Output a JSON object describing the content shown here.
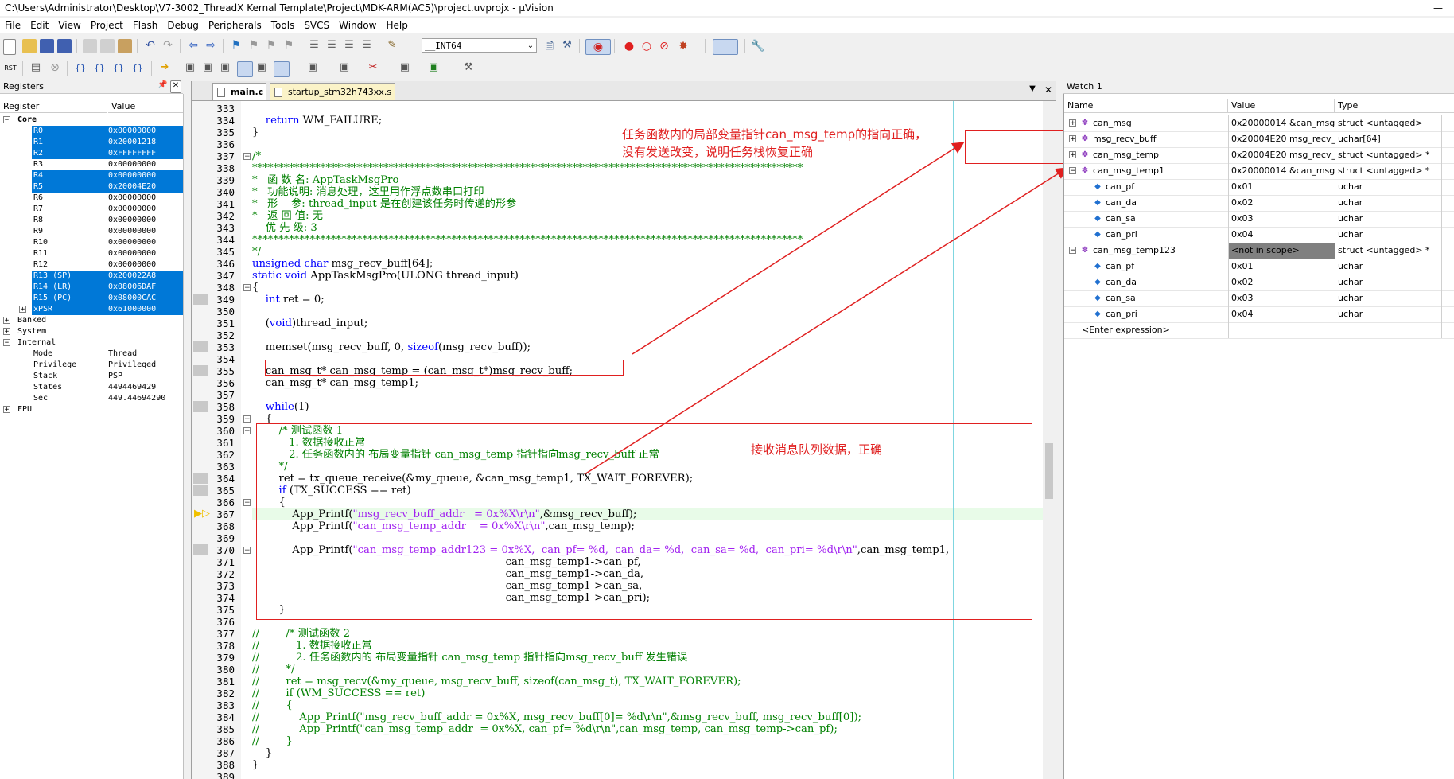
{
  "window": {
    "title": "C:\\Users\\Administrator\\Desktop\\V7-3002_ThreadX Kernal Template\\Project\\MDK-ARM(AC5)\\project.uvprojx - µVision"
  },
  "menu": [
    "File",
    "Edit",
    "View",
    "Project",
    "Flash",
    "Debug",
    "Peripherals",
    "Tools",
    "SVCS",
    "Window",
    "Help"
  ],
  "toolbar": {
    "combo_value": "__INT64"
  },
  "registers": {
    "title": "Registers",
    "col_register": "Register",
    "col_value": "Value",
    "rows": [
      {
        "name": "Core",
        "value": "",
        "level": 0,
        "exp": "−",
        "bold": true,
        "sel": false
      },
      {
        "name": "R0",
        "value": "0x00000000",
        "level": 2,
        "sel": true
      },
      {
        "name": "R1",
        "value": "0x20001218",
        "level": 2,
        "sel": true
      },
      {
        "name": "R2",
        "value": "0xFFFFFFFF",
        "level": 2,
        "sel": true
      },
      {
        "name": "R3",
        "value": "0x00000000",
        "level": 2,
        "sel": false
      },
      {
        "name": "R4",
        "value": "0x00000000",
        "level": 2,
        "sel": true
      },
      {
        "name": "R5",
        "value": "0x20004E20",
        "level": 2,
        "sel": true
      },
      {
        "name": "R6",
        "value": "0x00000000",
        "level": 2,
        "sel": false
      },
      {
        "name": "R7",
        "value": "0x00000000",
        "level": 2,
        "sel": false
      },
      {
        "name": "R8",
        "value": "0x00000000",
        "level": 2,
        "sel": false
      },
      {
        "name": "R9",
        "value": "0x00000000",
        "level": 2,
        "sel": false
      },
      {
        "name": "R10",
        "value": "0x00000000",
        "level": 2,
        "sel": false
      },
      {
        "name": "R11",
        "value": "0x00000000",
        "level": 2,
        "sel": false
      },
      {
        "name": "R12",
        "value": "0x00000000",
        "level": 2,
        "sel": false
      },
      {
        "name": "R13 (SP)",
        "value": "0x200022A8",
        "level": 2,
        "sel": true
      },
      {
        "name": "R14 (LR)",
        "value": "0x08006DAF",
        "level": 2,
        "sel": true
      },
      {
        "name": "R15 (PC)",
        "value": "0x08000CAC",
        "level": 2,
        "sel": true
      },
      {
        "name": "xPSR",
        "value": "0x61000000",
        "level": 2,
        "exp": "+",
        "sel": true
      },
      {
        "name": "Banked",
        "value": "",
        "level": 0,
        "exp": "+",
        "sel": false
      },
      {
        "name": "System",
        "value": "",
        "level": 0,
        "exp": "+",
        "sel": false
      },
      {
        "name": "Internal",
        "value": "",
        "level": 0,
        "exp": "−",
        "sel": false
      },
      {
        "name": "Mode",
        "value": "Thread",
        "level": 2,
        "sel": false
      },
      {
        "name": "Privilege",
        "value": "Privileged",
        "level": 2,
        "sel": false
      },
      {
        "name": "Stack",
        "value": "PSP",
        "level": 2,
        "sel": false
      },
      {
        "name": "States",
        "value": "4494469429",
        "level": 2,
        "sel": false
      },
      {
        "name": "Sec",
        "value": "449.44694290",
        "level": 2,
        "sel": false
      },
      {
        "name": "FPU",
        "value": "",
        "level": 0,
        "exp": "+",
        "sel": false
      }
    ]
  },
  "editor": {
    "tabs": [
      {
        "label": "main.c",
        "active": true
      },
      {
        "label": "startup_stm32h743xx.s",
        "active": false
      }
    ],
    "lines": [
      {
        "n": "333",
        "t": ""
      },
      {
        "n": "334",
        "t": "    return WM_FAILURE;"
      },
      {
        "n": "335",
        "t": "}"
      },
      {
        "n": "336",
        "t": ""
      },
      {
        "n": "337",
        "t": "/*",
        "c": "cmt",
        "f": "−"
      },
      {
        "n": "338",
        "t": "*********************************************************************************************************",
        "c": "cmt"
      },
      {
        "n": "339",
        "t": "*   函 数 名: AppTaskMsgPro",
        "c": "cmt"
      },
      {
        "n": "340",
        "t": "*   功能说明: 消息处理，这里用作浮点数串口打印",
        "c": "cmt"
      },
      {
        "n": "341",
        "t": "*   形    参: thread_input 是在创建该任务时传递的形参",
        "c": "cmt"
      },
      {
        "n": "342",
        "t": "*   返 回 值: 无",
        "c": "cmt"
      },
      {
        "n": "343",
        "t": "    优 先 级: 3",
        "c": "cmt"
      },
      {
        "n": "344",
        "t": "*********************************************************************************************************",
        "c": "cmt"
      },
      {
        "n": "345",
        "t": "*/",
        "c": "cmt"
      },
      {
        "n": "346",
        "t": "unsigned char msg_recv_buff[64];"
      },
      {
        "n": "347",
        "t": "static void AppTaskMsgPro(ULONG thread_input)"
      },
      {
        "n": "348",
        "t": "{",
        "f": "−"
      },
      {
        "n": "349",
        "t": "    int ret = 0;",
        "bp": true
      },
      {
        "n": "350",
        "t": ""
      },
      {
        "n": "351",
        "t": "    (void)thread_input;"
      },
      {
        "n": "352",
        "t": ""
      },
      {
        "n": "353",
        "t": "    memset(msg_recv_buff, 0, sizeof(msg_recv_buff));",
        "bp": true
      },
      {
        "n": "354",
        "t": ""
      },
      {
        "n": "355",
        "t": "    can_msg_t* can_msg_temp = (can_msg_t*)msg_recv_buff;",
        "bp": true
      },
      {
        "n": "356",
        "t": "    can_msg_t* can_msg_temp1;"
      },
      {
        "n": "357",
        "t": ""
      },
      {
        "n": "358",
        "t": "    while(1)",
        "bp": true
      },
      {
        "n": "359",
        "t": "    {",
        "f": "−"
      },
      {
        "n": "360",
        "t": "        /* 测试函数 1",
        "c": "cmt",
        "f": "−"
      },
      {
        "n": "361",
        "t": "           1. 数据接收正常",
        "c": "cmt"
      },
      {
        "n": "362",
        "t": "           2. 任务函数内的 布局变量指针 can_msg_temp 指针指向msg_recv_buff 正常",
        "c": "cmt"
      },
      {
        "n": "363",
        "t": "        */",
        "c": "cmt"
      },
      {
        "n": "364",
        "t": "        ret = tx_queue_receive(&my_queue, &can_msg_temp1, TX_WAIT_FOREVER);",
        "bp": true
      },
      {
        "n": "365",
        "t": "        if (TX_SUCCESS == ret)",
        "bp": true
      },
      {
        "n": "366",
        "t": "        {",
        "f": "−"
      },
      {
        "n": "367",
        "t": "            App_Printf(\"msg_recv_buff_addr   = 0x%X\\r\\n\",&msg_recv_buff);",
        "pc": true
      },
      {
        "n": "368",
        "t": "            App_Printf(\"can_msg_temp_addr    = 0x%X\\r\\n\",can_msg_temp);"
      },
      {
        "n": "369",
        "t": ""
      },
      {
        "n": "370",
        "t": "            App_Printf(\"can_msg_temp_addr123 = 0x%X,  can_pf= %d,  can_da= %d,  can_sa= %d,  can_pri= %d\\r\\n\",can_msg_temp1,",
        "bp": true,
        "f": "−"
      },
      {
        "n": "371",
        "t": "                                                                            can_msg_temp1->can_pf,"
      },
      {
        "n": "372",
        "t": "                                                                            can_msg_temp1->can_da,"
      },
      {
        "n": "373",
        "t": "                                                                            can_msg_temp1->can_sa,"
      },
      {
        "n": "374",
        "t": "                                                                            can_msg_temp1->can_pri);"
      },
      {
        "n": "375",
        "t": "        }"
      },
      {
        "n": "376",
        "t": ""
      },
      {
        "n": "377",
        "t": "//        /* 测试函数 2",
        "c": "cmt"
      },
      {
        "n": "378",
        "t": "//           1. 数据接收正常",
        "c": "cmt"
      },
      {
        "n": "379",
        "t": "//           2. 任务函数内的 布局变量指针 can_msg_temp 指针指向msg_recv_buff 发生错误",
        "c": "cmt"
      },
      {
        "n": "380",
        "t": "//        */",
        "c": "cmt"
      },
      {
        "n": "381",
        "t": "//        ret = msg_recv(&my_queue, msg_recv_buff, sizeof(can_msg_t), TX_WAIT_FOREVER);",
        "c": "cmt"
      },
      {
        "n": "382",
        "t": "//        if (WM_SUCCESS == ret)",
        "c": "cmt"
      },
      {
        "n": "383",
        "t": "//        {",
        "c": "cmt"
      },
      {
        "n": "384",
        "t": "//            App_Printf(\"msg_recv_buff_addr = 0x%X, msg_recv_buff[0]= %d\\r\\n\",&msg_recv_buff, msg_recv_buff[0]);",
        "c": "cmt"
      },
      {
        "n": "385",
        "t": "//            App_Printf(\"can_msg_temp_addr  = 0x%X, can_pf= %d\\r\\n\",can_msg_temp, can_msg_temp->can_pf);",
        "c": "cmt"
      },
      {
        "n": "386",
        "t": "//        }",
        "c": "cmt"
      },
      {
        "n": "387",
        "t": "    }"
      },
      {
        "n": "388",
        "t": "}"
      },
      {
        "n": "389",
        "t": ""
      }
    ]
  },
  "annotations": {
    "top_line1": "任务函数内的局部变量指针can_msg_temp的指向正确，",
    "top_line2": "没有发送改变，说明任务栈恢复正确",
    "right": "接收消息队列数据，正确"
  },
  "watch": {
    "title": "Watch 1",
    "col_name": "Name",
    "col_value": "Value",
    "col_type": "Type",
    "rows": [
      {
        "name": "can_msg",
        "value": "0x20000014 &can_msg",
        "type": "struct <untagged>",
        "level": 0,
        "exp": "+"
      },
      {
        "name": "msg_recv_buff",
        "value": "0x20004E20 msg_recv_...",
        "type": "uchar[64]",
        "level": 0,
        "exp": "+"
      },
      {
        "name": "can_msg_temp",
        "value": "0x20004E20 msg_recv_...",
        "type": "struct <untagged> *",
        "level": 0,
        "exp": "+"
      },
      {
        "name": "can_msg_temp1",
        "value": "0x20000014 &can_msg",
        "type": "struct <untagged> *",
        "level": 0,
        "exp": "−"
      },
      {
        "name": "can_pf",
        "value": "0x01",
        "type": "uchar",
        "level": 1
      },
      {
        "name": "can_da",
        "value": "0x02",
        "type": "uchar",
        "level": 1
      },
      {
        "name": "can_sa",
        "value": "0x03",
        "type": "uchar",
        "level": 1
      },
      {
        "name": "can_pri",
        "value": "0x04",
        "type": "uchar",
        "level": 1
      },
      {
        "name": "can_msg_temp123",
        "value": "<not in scope>",
        "type": "struct <untagged> *",
        "level": 0,
        "exp": "−",
        "grey": true
      },
      {
        "name": "can_pf",
        "value": "0x01",
        "type": "uchar",
        "level": 1
      },
      {
        "name": "can_da",
        "value": "0x02",
        "type": "uchar",
        "level": 1
      },
      {
        "name": "can_sa",
        "value": "0x03",
        "type": "uchar",
        "level": 1
      },
      {
        "name": "can_pri",
        "value": "0x04",
        "type": "uchar",
        "level": 1
      },
      {
        "name": "<Enter expression>",
        "value": "",
        "type": "",
        "level": 0,
        "enter": true
      }
    ]
  }
}
